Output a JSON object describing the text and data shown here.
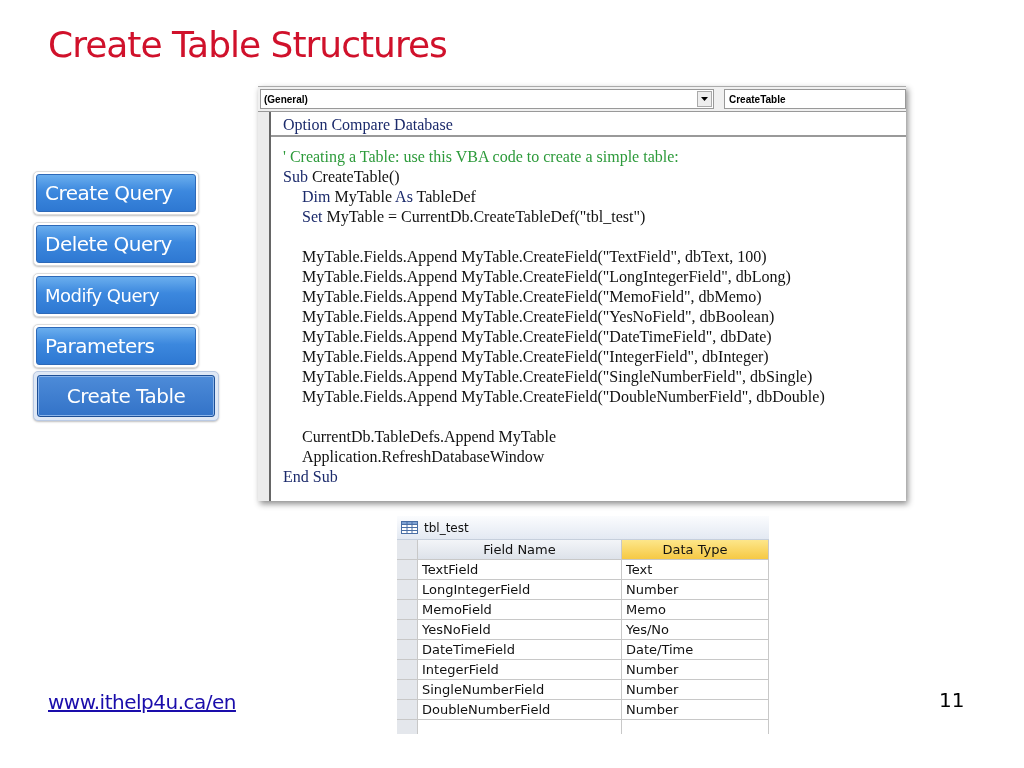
{
  "slide": {
    "title": "Create Table Structures",
    "footer_link": "www.ithelp4u.ca/en",
    "page_number": "11"
  },
  "nav_buttons": [
    {
      "label": "Create Query",
      "selected": false
    },
    {
      "label": "Delete Query",
      "selected": false
    },
    {
      "label": "Modify Query",
      "selected": false
    },
    {
      "label": "Parameters",
      "selected": false
    },
    {
      "label": "Create Table",
      "selected": true
    }
  ],
  "code_window": {
    "object_box": "(General)",
    "procedure_box": "CreateTable",
    "declarations": [
      {
        "kind": "keyword",
        "text": "Option Compare Database"
      }
    ],
    "comment": {
      "kind": "comment",
      "text": "' Creating a Table: use this VBA code to create a simple table:"
    },
    "procedure": {
      "header": [
        {
          "kind": "keyword",
          "text": "Sub"
        },
        {
          "kind": "plain",
          "text": " CreateTable()"
        }
      ],
      "body_blocks": [
        {
          "lines": [
            [
              {
                "kind": "keyword",
                "text": "Dim"
              },
              {
                "kind": "plain",
                "text": " MyTable "
              },
              {
                "kind": "keyword",
                "text": "As"
              },
              {
                "kind": "plain",
                "text": " TableDef"
              }
            ],
            [
              {
                "kind": "keyword",
                "text": "Set"
              },
              {
                "kind": "plain",
                "text": " MyTable = CurrentDb.CreateTableDef(\"tbl_test\")"
              }
            ]
          ]
        },
        {
          "lines": [
            [
              {
                "kind": "plain",
                "text": "MyTable.Fields.Append MyTable.CreateField(\"TextField\", dbText, 100)"
              }
            ],
            [
              {
                "kind": "plain",
                "text": "MyTable.Fields.Append MyTable.CreateField(\"LongIntegerField\", dbLong)"
              }
            ],
            [
              {
                "kind": "plain",
                "text": "MyTable.Fields.Append MyTable.CreateField(\"MemoField\", dbMemo)"
              }
            ],
            [
              {
                "kind": "plain",
                "text": "MyTable.Fields.Append MyTable.CreateField(\"YesNoField\", dbBoolean)"
              }
            ],
            [
              {
                "kind": "plain",
                "text": "MyTable.Fields.Append MyTable.CreateField(\"DateTimeField\", dbDate)"
              }
            ],
            [
              {
                "kind": "plain",
                "text": "MyTable.Fields.Append MyTable.CreateField(\"IntegerField\", dbInteger)"
              }
            ],
            [
              {
                "kind": "plain",
                "text": "MyTable.Fields.Append MyTable.CreateField(\"SingleNumberField\", dbSingle)"
              }
            ],
            [
              {
                "kind": "plain",
                "text": "MyTable.Fields.Append MyTable.CreateField(\"DoubleNumberField\", dbDouble)"
              }
            ]
          ]
        },
        {
          "lines": [
            [
              {
                "kind": "plain",
                "text": "CurrentDb.TableDefs.Append MyTable"
              }
            ],
            [
              {
                "kind": "plain",
                "text": "Application.RefreshDatabaseWindow"
              }
            ]
          ]
        }
      ],
      "end": [
        {
          "kind": "keyword",
          "text": "End Sub"
        }
      ]
    }
  },
  "table": {
    "title": "tbl_test",
    "columns": [
      {
        "label": "Field Name",
        "selected": false
      },
      {
        "label": "Data Type",
        "selected": true
      }
    ],
    "rows": [
      [
        "TextField",
        "Text"
      ],
      [
        "LongIntegerField",
        "Number"
      ],
      [
        "MemoField",
        "Memo"
      ],
      [
        "YesNoField",
        "Yes/No"
      ],
      [
        "DateTimeField",
        "Date/Time"
      ],
      [
        "IntegerField",
        "Number"
      ],
      [
        "SingleNumberField",
        "Number"
      ],
      [
        "DoubleNumberField",
        "Number"
      ]
    ]
  }
}
